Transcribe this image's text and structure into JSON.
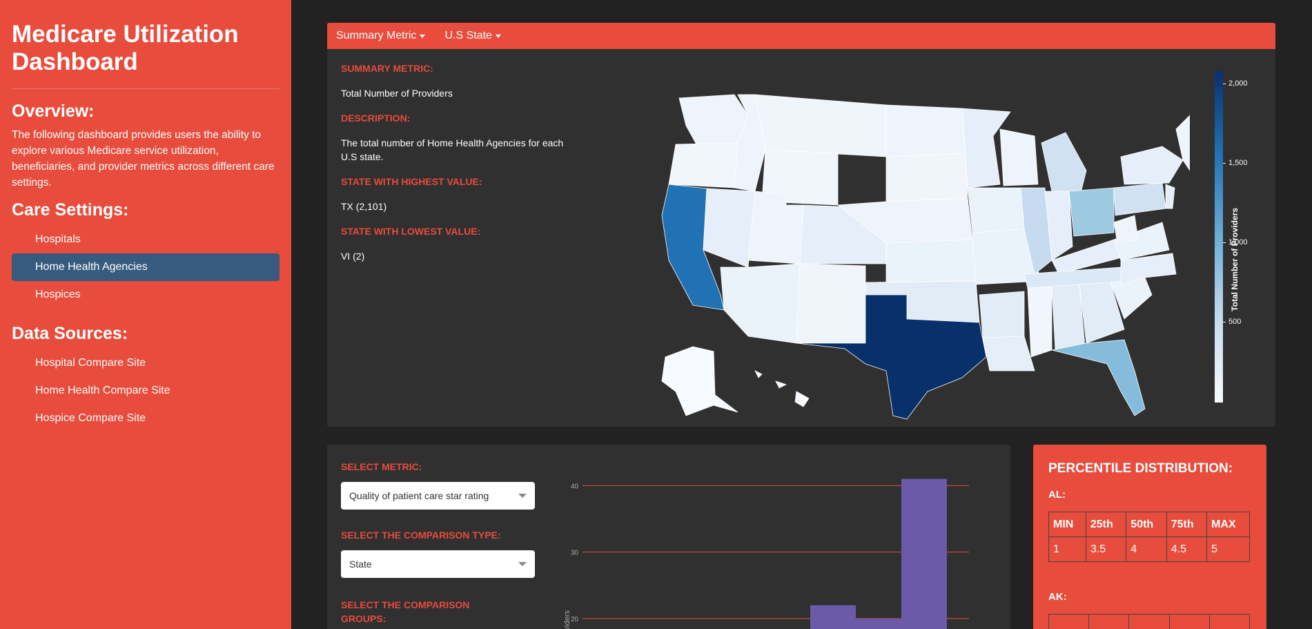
{
  "sidebar": {
    "title": "Medicare Utilization Dashboard",
    "overview_heading": "Overview:",
    "overview_text": "The following dashboard provides users the ability to explore various Medicare service utilization, beneficiaries, and provider metrics across different care settings.",
    "care_heading": "Care Settings:",
    "care_items": [
      "Hospitals",
      "Home Health Agencies",
      "Hospices"
    ],
    "care_active": "Home Health Agencies",
    "sources_heading": "Data Sources:",
    "source_items": [
      "Hospital Compare Site",
      "Home Health Compare Site",
      "Hospice Compare Site"
    ]
  },
  "topcard": {
    "nav": [
      "Summary Metric",
      "U.S State"
    ],
    "summary_metric_label": "SUMMARY METRIC:",
    "summary_metric_value": "Total Number of Providers",
    "description_label": "DESCRIPTION:",
    "description_value": "The total number of Home Health Agencies for each U.S state.",
    "highest_label": "STATE WITH HIGHEST VALUE:",
    "highest_value": "TX (2,101)",
    "lowest_label": "STATE WITH LOWEST VALUE:",
    "lowest_value": "VI (2)",
    "colorbar": {
      "title": "Total Number of Providers",
      "ticks": [
        "2,000",
        "1,500",
        "1,000",
        "500"
      ],
      "colors": [
        "#08306b",
        "#2171b5",
        "#6baed6",
        "#c6dbef",
        "#f7fbff"
      ]
    }
  },
  "comparison": {
    "metric_label": "SELECT METRIC:",
    "metric_value": "Quality of patient care star rating",
    "type_label": "SELECT THE COMPARISON TYPE:",
    "type_value": "State",
    "groups_label": "SELECT THE COMPARISON GROUPS:"
  },
  "chart_data": {
    "type": "bar",
    "ylabel": "# of Providers",
    "yticks": [
      20,
      30,
      40
    ],
    "ylim": [
      15,
      42
    ],
    "bars": [
      {
        "value": 22
      },
      {
        "value": 20
      },
      {
        "value": 41
      }
    ],
    "colors": {
      "bar": "#6a5aa8",
      "grid": "#e74c3c"
    }
  },
  "percentile": {
    "title": "PERCENTILE DISTRIBUTION:",
    "headers": [
      "MIN",
      "25th",
      "50th",
      "75th",
      "MAX"
    ],
    "states": [
      {
        "name": "AL:",
        "values": [
          "1",
          "3.5",
          "4",
          "4.5",
          "5"
        ]
      },
      {
        "name": "AK:",
        "values": []
      }
    ]
  }
}
